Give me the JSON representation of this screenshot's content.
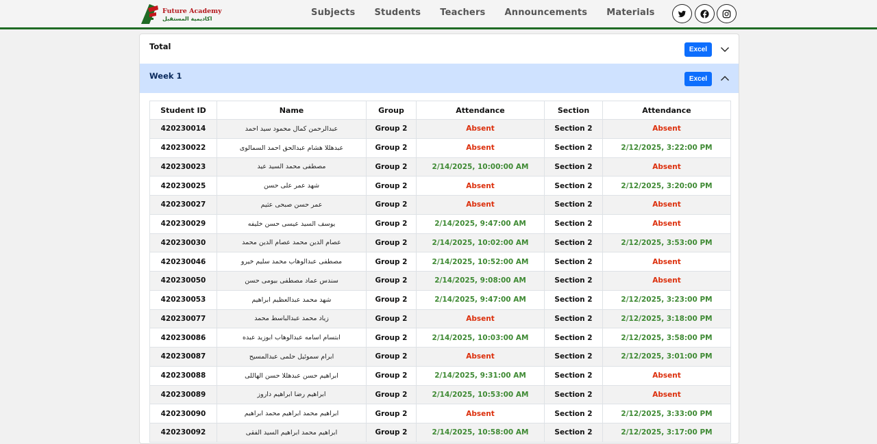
{
  "brand": {
    "name_en": "Future Academy",
    "name_ar": "اكاديمية المستقبل"
  },
  "nav": [
    "Subjects",
    "Students",
    "Teachers",
    "Announcements",
    "Materials"
  ],
  "social": [
    {
      "icon": "twitter-icon"
    },
    {
      "icon": "facebook-icon"
    },
    {
      "icon": "instagram-icon"
    }
  ],
  "colors": {
    "accent": "#0d6efd",
    "brand_green": "#1f6b24",
    "brand_red": "#b3161b",
    "absent": "#dc2f0c",
    "present": "#3f8a34",
    "week_header": "#cfe2ff"
  },
  "accordion": {
    "total": {
      "title": "Total",
      "excel_label": "Excel",
      "expanded": false
    },
    "week": {
      "title": "Week 1",
      "excel_label": "Excel",
      "expanded": true
    }
  },
  "table": {
    "headers": [
      "Student ID",
      "Name",
      "Group",
      "Attendance",
      "Section",
      "Attendance"
    ],
    "rows": [
      {
        "id": "420230014",
        "name": "عبدالرحمن كمال محمود سيد احمد",
        "group": "Group 2",
        "group_att": "Absent",
        "section": "Section 2",
        "section_att": "Absent"
      },
      {
        "id": "420230022",
        "name": "عبدهللا هشام عبدالحق احمد السمالوى",
        "group": "Group 2",
        "group_att": "Absent",
        "section": "Section 2",
        "section_att": "2/12/2025, 3:22:00 PM"
      },
      {
        "id": "420230023",
        "name": "مصطفى محمد السيد عيد",
        "group": "Group 2",
        "group_att": "2/14/2025, 10:00:00 AM",
        "section": "Section 2",
        "section_att": "Absent"
      },
      {
        "id": "420230025",
        "name": "شهد عمر على حسن",
        "group": "Group 2",
        "group_att": "Absent",
        "section": "Section 2",
        "section_att": "2/12/2025, 3:20:00 PM"
      },
      {
        "id": "420230027",
        "name": "عمر حسن صبحى عثيم",
        "group": "Group 2",
        "group_att": "Absent",
        "section": "Section 2",
        "section_att": "Absent"
      },
      {
        "id": "420230029",
        "name": "يوسف السيد عيسى حسن خليفه",
        "group": "Group 2",
        "group_att": "2/14/2025, 9:47:00 AM",
        "section": "Section 2",
        "section_att": "Absent"
      },
      {
        "id": "420230030",
        "name": "عصام الدين محمد عصام الدين محمد",
        "group": "Group 2",
        "group_att": "2/14/2025, 10:02:00 AM",
        "section": "Section 2",
        "section_att": "2/12/2025, 3:53:00 PM"
      },
      {
        "id": "420230046",
        "name": "مصطفى عبدالوهاب محمد سليم خيرو",
        "group": "Group 2",
        "group_att": "2/14/2025, 10:52:00 AM",
        "section": "Section 2",
        "section_att": "Absent"
      },
      {
        "id": "420230050",
        "name": "سندس عماد مصطفى بيومى حسن",
        "group": "Group 2",
        "group_att": "2/14/2025, 9:08:00 AM",
        "section": "Section 2",
        "section_att": "Absent"
      },
      {
        "id": "420230053",
        "name": "شهد محمد عبدالعظيم ابراهيم",
        "group": "Group 2",
        "group_att": "2/14/2025, 9:47:00 AM",
        "section": "Section 2",
        "section_att": "2/12/2025, 3:23:00 PM"
      },
      {
        "id": "420230077",
        "name": "زياد محمد عبدالباسط محمد",
        "group": "Group 2",
        "group_att": "Absent",
        "section": "Section 2",
        "section_att": "2/12/2025, 3:18:00 PM"
      },
      {
        "id": "420230086",
        "name": "ابتسام اسامه عبدالوهاب ابوزيد عبده",
        "group": "Group 2",
        "group_att": "2/14/2025, 10:03:00 AM",
        "section": "Section 2",
        "section_att": "2/12/2025, 3:58:00 PM"
      },
      {
        "id": "420230087",
        "name": "ابرام سموئيل حلمى عبدالمسيح",
        "group": "Group 2",
        "group_att": "Absent",
        "section": "Section 2",
        "section_att": "2/12/2025, 3:01:00 PM"
      },
      {
        "id": "420230088",
        "name": "ابراهيم حسن عبدهللا حسن الهاللى",
        "group": "Group 2",
        "group_att": "2/14/2025, 9:31:00 AM",
        "section": "Section 2",
        "section_att": "Absent"
      },
      {
        "id": "420230089",
        "name": "ابراهيم رضا ابراهيم داروز",
        "group": "Group 2",
        "group_att": "2/14/2025, 10:53:00 AM",
        "section": "Section 2",
        "section_att": "Absent"
      },
      {
        "id": "420230090",
        "name": "ابراهيم محمد ابراهيم محمد ابراهيم",
        "group": "Group 2",
        "group_att": "Absent",
        "section": "Section 2",
        "section_att": "2/12/2025, 3:33:00 PM"
      },
      {
        "id": "420230092",
        "name": "ابراهيم محمد ابراهيم السيد الفقى",
        "group": "Group 2",
        "group_att": "2/14/2025, 10:58:00 AM",
        "section": "Section 2",
        "section_att": "2/12/2025, 3:17:00 PM"
      }
    ]
  }
}
